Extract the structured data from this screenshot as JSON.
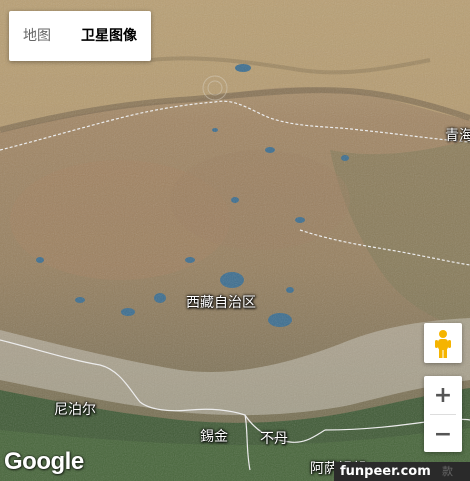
{
  "map_type_control": {
    "map_label": "地图",
    "satellite_label": "卫星图像",
    "selected": "satellite"
  },
  "place_labels": {
    "qinghai": "青海",
    "tibet": "西藏自治区",
    "nepal": "尼泊尔",
    "sikkim": "錫金",
    "bhutan": "不丹",
    "arunachal": "阿萨姆邦"
  },
  "controls": {
    "pegman_icon": "street-view-pegman-icon",
    "zoom_in": "+",
    "zoom_out": "−"
  },
  "logo_text": "Google",
  "watermark_text": "funpeer.com",
  "terms_partial": "款",
  "colors": {
    "plateau": "#9c8566",
    "desert": "#b79a6f",
    "lowland_green": "#3f5a35",
    "lakes": "#3b6d8f",
    "border": "#e8e8e8"
  }
}
